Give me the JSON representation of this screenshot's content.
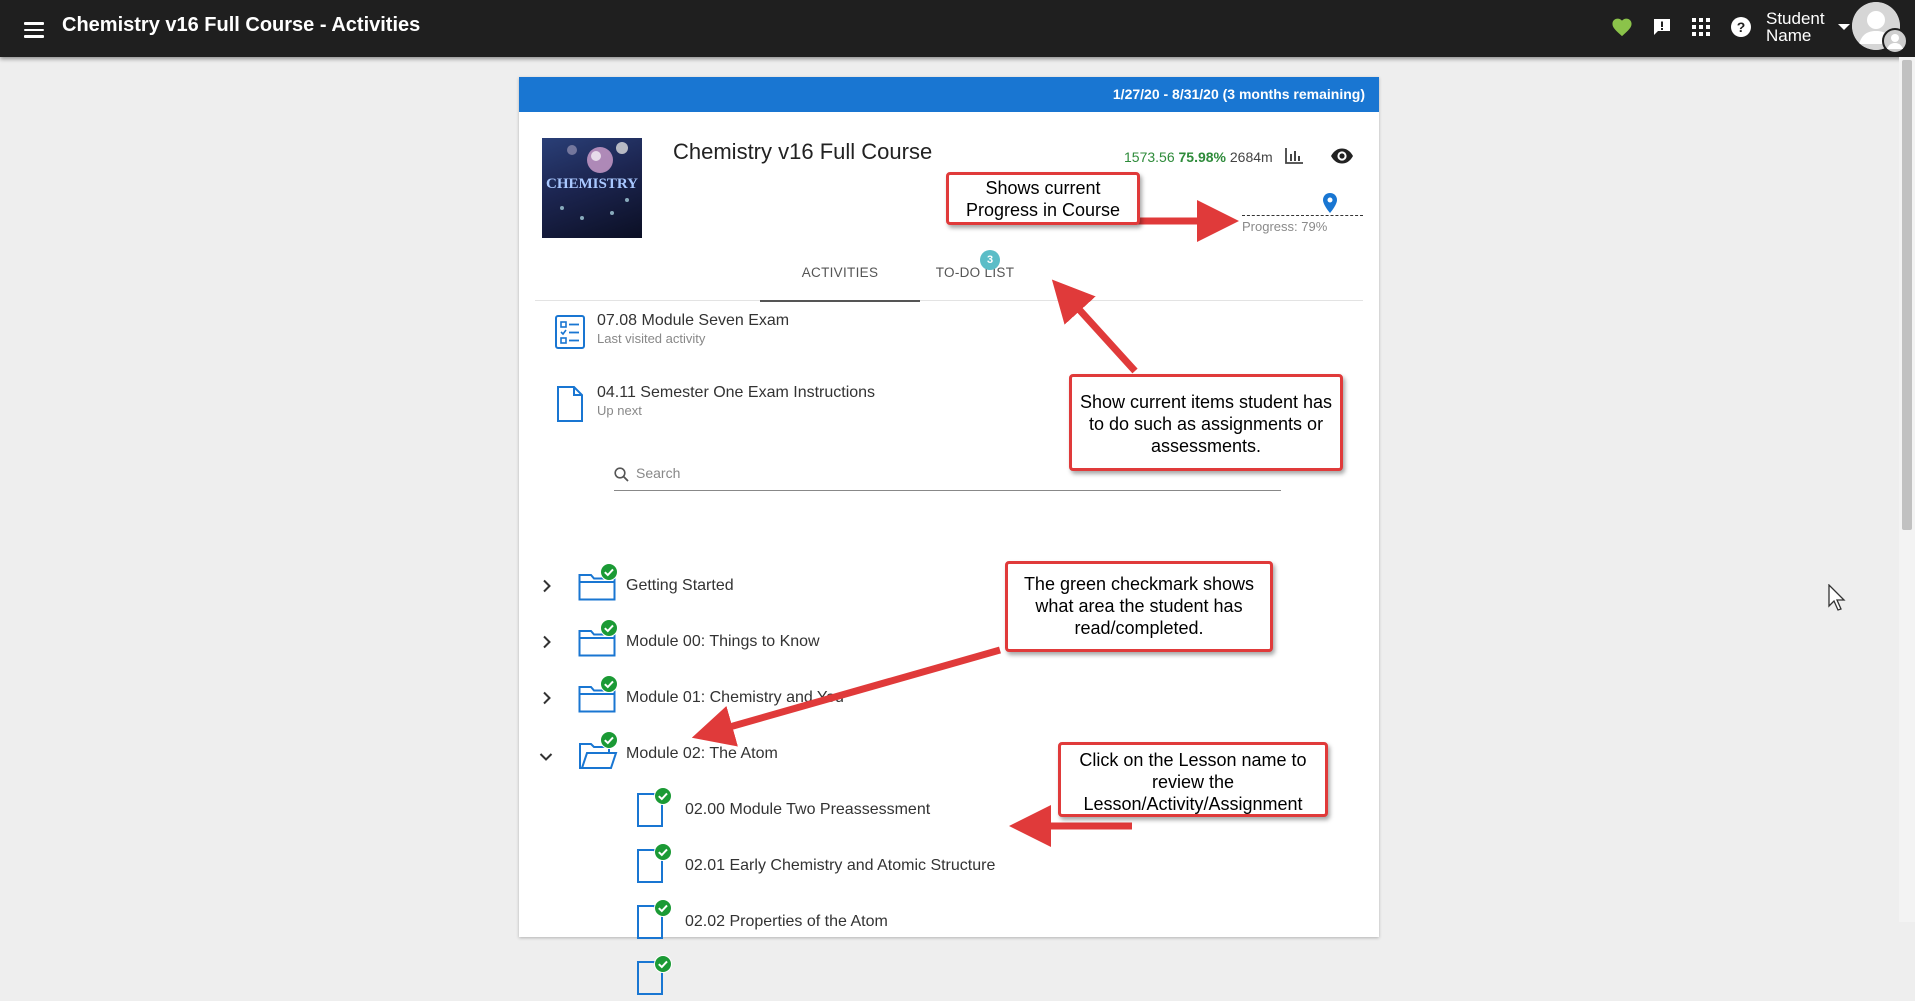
{
  "topbar": {
    "title": "Chemistry v16 Full Course  - Activities",
    "student_name_line1": "Student",
    "student_name_line2": "Name",
    "icons": [
      "menu-icon",
      "heart-icon",
      "feedback-icon",
      "apps-grid-icon",
      "help-icon",
      "avatar-icon"
    ],
    "heart_color": "#8bc34a"
  },
  "course": {
    "date_range": "1/27/20 - 8/31/20 (3 months remaining)",
    "thumbnail_text": "CHEMISTRY",
    "title": "Chemistry v16 Full Course",
    "points": "1573.56",
    "percent": "75.98%",
    "minutes": "2684m",
    "progress_label": "Progress: 79%",
    "progress_value": 0.79,
    "header_color": "#1976d2"
  },
  "tabs": [
    {
      "label": "ACTIVITIES",
      "active": true
    },
    {
      "label": "TO-DO LIST",
      "badge": "3"
    }
  ],
  "recent": [
    {
      "title": "07.08 Module Seven Exam",
      "subtitle": "Last visited activity",
      "icon": "checklist-icon"
    },
    {
      "title": "04.11 Semester One Exam Instructions",
      "subtitle": "Up next",
      "icon": "document-icon"
    }
  ],
  "search": {
    "placeholder": "Search"
  },
  "modules": [
    {
      "label": "Getting Started",
      "expanded": false,
      "completed": true
    },
    {
      "label": "Module 00: Things to Know",
      "expanded": false,
      "completed": true
    },
    {
      "label": "Module 01: Chemistry and You",
      "expanded": false,
      "completed": true
    },
    {
      "label": "Module 02: The Atom",
      "expanded": true,
      "completed": true
    }
  ],
  "lessons": [
    {
      "label": "02.00 Module Two Preassessment",
      "completed": true
    },
    {
      "label": "02.01 Early Chemistry and Atomic Structure",
      "completed": true
    },
    {
      "label": "02.02 Properties of the Atom",
      "completed": true
    },
    {
      "label": "",
      "completed": true
    }
  ],
  "annotations": {
    "progress": "Shows current Progress in Course",
    "todo": "Show current items student has to do such as assignments or assessments.",
    "checkmark": "The green checkmark shows what area the student has read/completed.",
    "lesson": "Click on the Lesson name to review the Lesson/Activity/Assignment"
  },
  "colors": {
    "check_green": "#1b9a35",
    "folder_blue": "#1976d2",
    "annotation_red": "#e03a3a"
  }
}
